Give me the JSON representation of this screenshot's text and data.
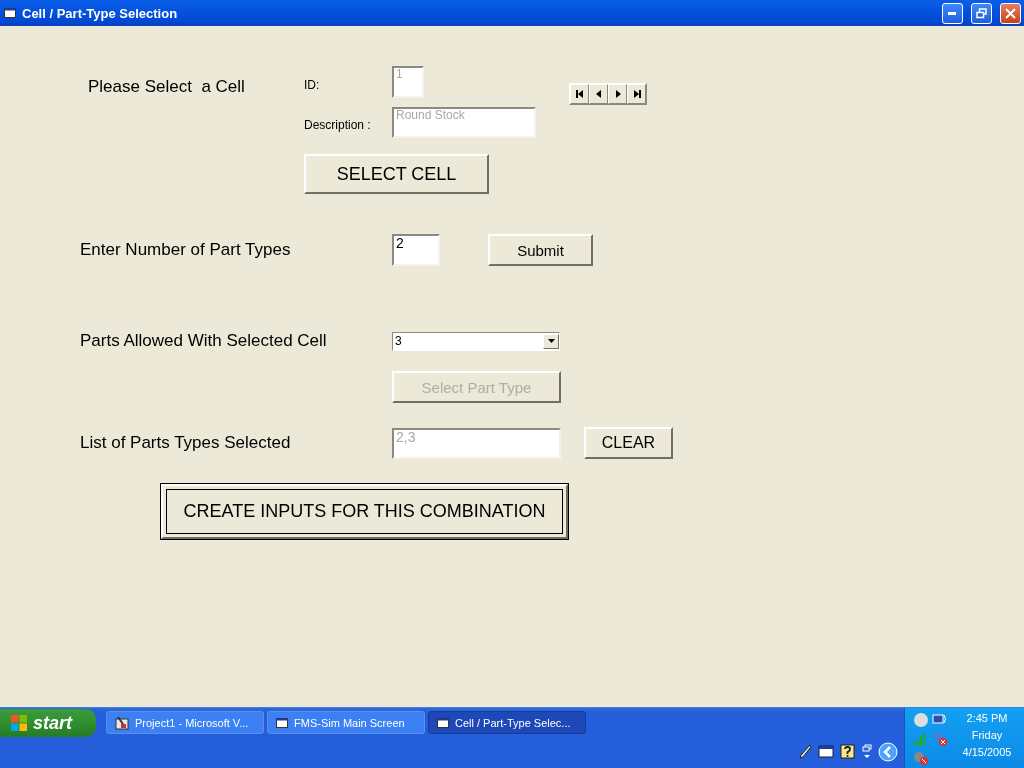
{
  "window": {
    "title": "Cell / Part-Type Selection"
  },
  "cell_section": {
    "label": "Please Select  a Cell",
    "id_label": "ID:",
    "id_field": {
      "value": "1",
      "disabled": true
    },
    "description_label": "Description :",
    "description_field": {
      "value": "Round Stock",
      "disabled": true
    },
    "select_button": {
      "label": "SELECT  CELL",
      "disabled": false
    }
  },
  "part_count": {
    "label": "Enter Number of Part Types",
    "field": {
      "value": "2",
      "disabled": false
    },
    "submit_button": {
      "label": "Submit",
      "disabled": false
    }
  },
  "parts_allowed": {
    "label": "Parts Allowed With Selected Cell",
    "combo_value": "3",
    "select_button": {
      "label": "Select Part Type",
      "disabled": true
    }
  },
  "parts_list": {
    "label": "List of Parts Types Selected",
    "field": {
      "value": "2,3",
      "disabled": true
    },
    "clear_button": {
      "label": "CLEAR",
      "disabled": false
    }
  },
  "create_button": {
    "label": "CREATE INPUTS FOR THIS COMBINATION",
    "default": true
  },
  "taskbar": {
    "start": "start",
    "tasks": [
      {
        "label": "Project1 - Microsoft V...",
        "selected": false,
        "kind": "vb"
      },
      {
        "label": "FMS-Sim Main Screen",
        "selected": false,
        "kind": "form"
      },
      {
        "label": "Cell / Part-Type Selec...",
        "selected": true,
        "kind": "form"
      }
    ],
    "clock": {
      "time": "2:45 PM",
      "day": "Friday",
      "date": "4/15/2005"
    }
  }
}
